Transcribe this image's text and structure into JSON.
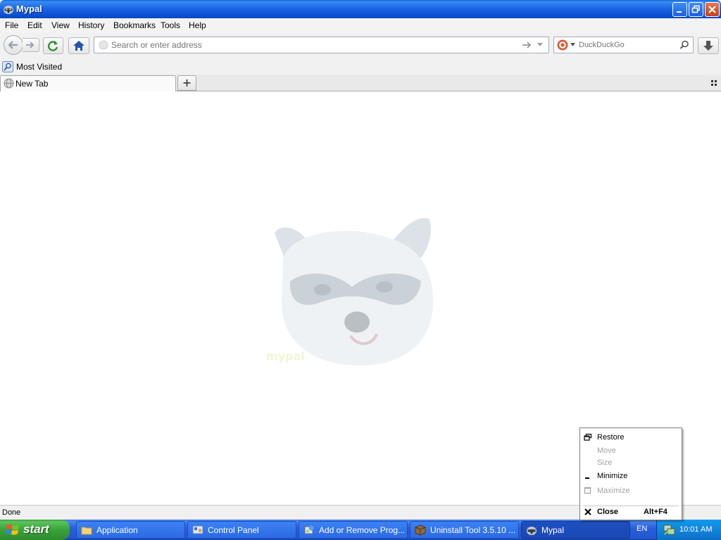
{
  "window": {
    "title": "Mypal",
    "app_icon": "raccoon-icon",
    "buttons": [
      "minimize-icon",
      "restore-icon",
      "close-icon"
    ]
  },
  "menubar": [
    "File",
    "Edit",
    "View",
    "History",
    "Bookmarks",
    "Tools",
    "Help"
  ],
  "toolbar": {
    "url_placeholder": "Search or enter address",
    "search_engine": "DuckDuckGo",
    "icons": [
      "back-icon",
      "forward-icon",
      "reload-icon",
      "home-icon",
      "go-arrow-icon",
      "dropdown-icon",
      "search-icon",
      "download-icon"
    ]
  },
  "bookmarks": {
    "items": [
      "Most Visited"
    ]
  },
  "tabs": {
    "items": [
      "New Tab"
    ],
    "new_tab_icon": "plus-icon",
    "list_all_icon": "grid-icon"
  },
  "content": {
    "watermark": "raccoon-logo"
  },
  "statusbar": {
    "text": "Done"
  },
  "context_menu": {
    "items": [
      {
        "label": "Restore",
        "enabled": true,
        "icon": "restore-icon"
      },
      {
        "label": "Move",
        "enabled": false
      },
      {
        "label": "Size",
        "enabled": false
      },
      {
        "label": "Minimize",
        "enabled": true,
        "icon": "minimize-icon"
      },
      {
        "label": "Maximize",
        "enabled": false,
        "icon": "maximize-icon"
      },
      {
        "label": "Close",
        "enabled": true,
        "icon": "close-icon",
        "shortcut": "Alt+F4",
        "bold": true
      }
    ]
  },
  "taskbar": {
    "start_label": "start",
    "tasks": [
      {
        "label": "Application",
        "icon": "folder-icon"
      },
      {
        "label": "Control Panel",
        "icon": "control-panel-icon"
      },
      {
        "label": "Add or Remove Prog...",
        "icon": "add-remove-programs-icon"
      },
      {
        "label": "Uninstall Tool 3.5.10 ...",
        "icon": "uninstall-tool-icon"
      },
      {
        "label": "Mypal",
        "icon": "raccoon-icon",
        "active": true
      }
    ],
    "language": "EN",
    "clock": "10:01 AM"
  },
  "colors": {
    "titlebar": "#1a67e6",
    "taskbar": "#2457d0",
    "start": "#39a239",
    "tray": "#1284db"
  }
}
